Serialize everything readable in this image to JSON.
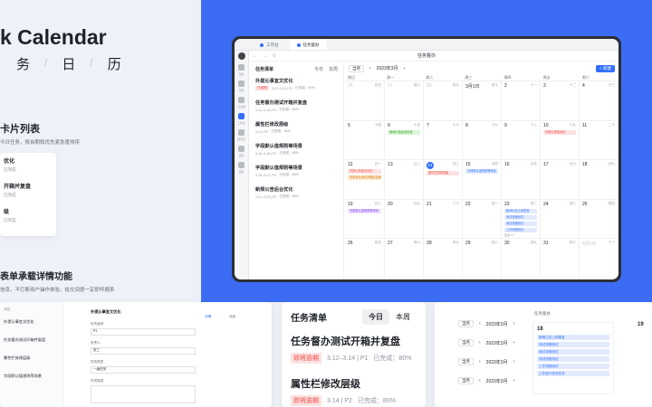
{
  "hero": {
    "title": "k Calendar",
    "subtitle": [
      "务",
      "日",
      "历"
    ],
    "sep": "/"
  },
  "section1": {
    "title": "卡片列表",
    "desc": "今日任务，按自期和优先紧急度排序"
  },
  "mini_card": {
    "rows": [
      {
        "title": "优化",
        "meta": "已完成"
      },
      {
        "title": "开箱并复盘",
        "meta": "已完成"
      },
      {
        "title": "级",
        "meta": "已完成"
      }
    ]
  },
  "section2": {
    "title": "表单承载详情功能",
    "desc": "信息，不打断用户操作体验，给交间提一定即呼顺系"
  },
  "window": {
    "tabs": [
      {
        "label": "工作台",
        "active": false
      },
      {
        "label": "任务督办",
        "active": true
      }
    ],
    "nav_title": "任务督办",
    "rail": [
      "消息",
      "日历",
      "云文档",
      "工作台",
      "通讯录",
      "任务",
      "更多"
    ],
    "tasks": {
      "header": "任务清单",
      "toggle": [
        "今日",
        "本周"
      ],
      "items": [
        {
          "title": "外提沁事宜文优化",
          "tag": "已逾期",
          "date": "3.10–3.15 | P1",
          "done": "已完成：80%"
        },
        {
          "title": "任务督办测试开箱并复盘",
          "tag": "",
          "date": "3.12–3.14 | P1",
          "done": "已完成：80%"
        },
        {
          "title": "属性栏修改层级",
          "tag": "",
          "date": "3.14 | P2",
          "done": "已完成：80%"
        },
        {
          "title": "字段默认值规则等场景",
          "tag": "",
          "date": "3.15–3.18 | P2",
          "done": "已完成：80%"
        },
        {
          "title": "字段默认值规则等场景",
          "tag": "",
          "date": "3.15–3.17 | P2",
          "done": "已完成：80%"
        },
        {
          "title": "新规公告后台优化",
          "tag": "",
          "date": "3.21–3.23 | P2",
          "done": "已完成：80%"
        }
      ]
    },
    "calendar": {
      "today_btn": "当月",
      "month": "2023年3月",
      "new_btn": "+ 新建",
      "weekdays": [
        "周日",
        "周一",
        "周二",
        "周三",
        "周四",
        "周五",
        "周六"
      ],
      "cells": [
        {
          "n": "26",
          "l": "初五",
          "dim": true
        },
        {
          "n": "27",
          "l": "初六",
          "dim": true
        },
        {
          "n": "28",
          "l": "初七",
          "dim": true
        },
        {
          "n": "3月1日",
          "l": "初十"
        },
        {
          "n": "2",
          "l": "十一"
        },
        {
          "n": "3",
          "l": "十二"
        },
        {
          "n": "4",
          "l": "十三"
        },
        {
          "n": "5",
          "l": "十四"
        },
        {
          "n": "6",
          "l": "十五",
          "ev": [
            [
              "g",
              "新闻公告后台优化"
            ]
          ]
        },
        {
          "n": "7",
          "l": "十六"
        },
        {
          "n": "8",
          "l": "十七"
        },
        {
          "n": "9",
          "l": "十八"
        },
        {
          "n": "10",
          "l": "十九",
          "ev": [
            [
              "r",
              "外提沁事宜优化"
            ]
          ]
        },
        {
          "n": "11",
          "l": "二十"
        },
        {
          "n": "12",
          "l": "廿一",
          "ev": [
            [
              "r",
              "外提沁事宜文优化"
            ],
            [
              "o",
              "任务督办测试开箱并复盘"
            ]
          ]
        },
        {
          "n": "13",
          "l": "廿二"
        },
        {
          "n": "14",
          "l": "廿三",
          "today": true,
          "ev": [
            [
              "r",
              "属性栏修改层级"
            ]
          ]
        },
        {
          "n": "15",
          "l": "廿四",
          "ev": [
            [
              "b",
              "字段默认值规则等场景"
            ]
          ]
        },
        {
          "n": "16",
          "l": "廿五"
        },
        {
          "n": "17",
          "l": "廿六"
        },
        {
          "n": "18",
          "l": "廿七"
        },
        {
          "n": "19",
          "l": "廿八",
          "ev": [
            [
              "p",
              "字段默认值规则等场景"
            ]
          ]
        },
        {
          "n": "20",
          "l": "廿九"
        },
        {
          "n": "21",
          "l": "三十"
        },
        {
          "n": "22",
          "l": "初一"
        },
        {
          "n": "23",
          "l": "初二",
          "ev": [
            [
              "b",
              "新闻公告上线事宜"
            ],
            [
              "b",
              "测试流程测试"
            ],
            [
              "b",
              "测试流程测试"
            ],
            [
              "b",
              "工作流程测试"
            ]
          ],
          "more": "更多3个"
        },
        {
          "n": "24",
          "l": "初三"
        },
        {
          "n": "25",
          "l": "初四"
        },
        {
          "n": "26",
          "l": "初五"
        },
        {
          "n": "27",
          "l": "初六"
        },
        {
          "n": "28",
          "l": "初七"
        },
        {
          "n": "29",
          "l": "初八"
        },
        {
          "n": "30",
          "l": "初九"
        },
        {
          "n": "31",
          "l": "初十"
        },
        {
          "n": "4月1日",
          "l": "十一",
          "dim": true
        }
      ]
    }
  },
  "bottom_card2": {
    "header": "任务清单",
    "toggle": [
      "今日",
      "本周"
    ],
    "items": [
      {
        "title": "任务督办测试开箱并复盘",
        "tag": "即将逾期",
        "date": "3.12–3.14 | P1",
        "done": "已完成：80%"
      },
      {
        "title": "属性栏修改层级",
        "tag": "即将逾期",
        "date": "3.14 | P2",
        "done": "已完成：80%"
      }
    ]
  },
  "bottom_card3": {
    "rows": [
      {
        "btn": "当月",
        "month": "2023年3月"
      },
      {
        "btn": "当月",
        "month": "2023年3月"
      },
      {
        "btn": "当月",
        "month": "2023年3月"
      },
      {
        "btn": "当月",
        "month": "2023年3月"
      }
    ],
    "panel_title": "任务督办",
    "day": "18",
    "events": [
      "新闻公告上线事宜",
      "测试流程测试",
      "测试流程测试",
      "测试流程测试",
      "工作流程测试",
      "工作进行任务任务"
    ],
    "side_day": "19"
  },
  "bottom_card1": {
    "title": "外提沁事宜文优化",
    "tabs": [
      "详情",
      "动态"
    ],
    "fields": [
      "优先级别",
      "负责人",
      "任务类型",
      "任务描述"
    ],
    "values": [
      "P1",
      "张三",
      "一级任务"
    ]
  }
}
